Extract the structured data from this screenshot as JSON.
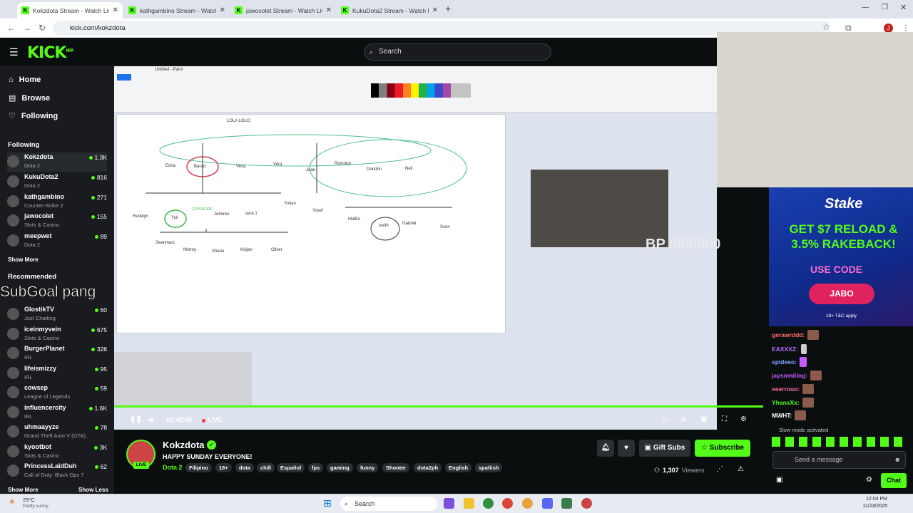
{
  "browser": {
    "tabs": [
      {
        "title": "Kokzdota Stream - Watch Live"
      },
      {
        "title": "kathgambino Stream - Watch Live"
      },
      {
        "title": "jawocolet Stream - Watch Live"
      },
      {
        "title": "KukuDota2 Stream - Watch Live"
      }
    ],
    "url": "kick.com/kokzdota",
    "profile_initial": "J"
  },
  "header": {
    "logo": "KICK",
    "logo_sup": "BETA",
    "search_placeholder": "Search"
  },
  "sidebar": {
    "nav": [
      {
        "label": "Home"
      },
      {
        "label": "Browse"
      },
      {
        "label": "Following"
      }
    ],
    "following_title": "Following",
    "following": [
      {
        "name": "Kokzdota",
        "category": "Dota 2",
        "viewers": "1.3K"
      },
      {
        "name": "KukuDota2",
        "category": "Dota 2",
        "viewers": "816"
      },
      {
        "name": "kathgambino",
        "category": "Counter-Strike 2",
        "viewers": "271"
      },
      {
        "name": "jawocolet",
        "category": "Slots & Casino",
        "viewers": "155"
      },
      {
        "name": "meepwet",
        "category": "Dota 2",
        "viewers": "89"
      }
    ],
    "show_more": "Show More",
    "recommended_title": "Recommended",
    "recommended": [
      {
        "name": "GlostikTV",
        "category": "Just Chatting",
        "viewers": "60"
      },
      {
        "name": "iceinmyvein",
        "category": "Slots & Casino",
        "viewers": "675"
      },
      {
        "name": "BurgerPlanet",
        "category": "IRL",
        "viewers": "328"
      },
      {
        "name": "lifeismizzy",
        "category": "IRL",
        "viewers": "95"
      },
      {
        "name": "cowsep",
        "category": "League of Legends",
        "viewers": "59"
      },
      {
        "name": "influencercity",
        "category": "IRL",
        "viewers": "1.6K"
      },
      {
        "name": "uhmaayyze",
        "category": "Grand Theft Auto V (GTA)",
        "viewers": "78"
      },
      {
        "name": "kyootbot",
        "category": "Slots & Casino",
        "viewers": "3K"
      },
      {
        "name": "PrincessLaidDuh",
        "category": "Call of Duty: Black Ops 7",
        "viewers": "62"
      }
    ],
    "show_more_2": "Show More",
    "show_less": "Show Less"
  },
  "video": {
    "overlay_text": "SubGoal pang",
    "bp_text": "BP 589/800",
    "paint_title": "Untitled - Paint",
    "diagram_labels": [
      "LOLA LOLO",
      "Edna",
      "Barad",
      "Vesa",
      "Vera",
      "Joan",
      "Romnick",
      "Dondon",
      "Neil",
      "Rudelyn",
      "Yuri",
      "EXPOSURE",
      "Johnrex",
      "vera 1",
      "Yohan",
      "Yosef",
      "MatEo",
      "keith",
      "Gabriel",
      "Sven",
      "Seanmarc",
      "Mctroy",
      "Shane",
      "Kidjan",
      "Oliver"
    ],
    "time": "02:42:00",
    "live": "LIVE"
  },
  "ad": {
    "brand": "Stake",
    "headline": "GET $7 RELOAD & 3.5% RAKEBACK!",
    "use_code": "USE CODE",
    "code": "JABO",
    "terms": "18+ T&C apply"
  },
  "chat": {
    "messages": [
      {
        "user": "gerawrddd:",
        "color": "#ff6b6b"
      },
      {
        "user": "EAXXXZ:",
        "color": "#b46bff"
      },
      {
        "user": "spideeo:",
        "color": "#7aa7ff"
      },
      {
        "user": "jaysnmiting:",
        "color": "#c45bff"
      },
      {
        "user": "eeerrooo:",
        "color": "#ff6b9d"
      },
      {
        "user": "YhanxXx:",
        "color": "#53fc18"
      },
      {
        "user": "MWHT:",
        "color": "#ffffff"
      }
    ],
    "slow_mode": "Slow mode activated",
    "placeholder": "Send a message",
    "chat_button": "Chat"
  },
  "stream": {
    "streamer": "Kokzdota",
    "title": "HAPPY SUNDAY EVERYONE!",
    "category": "Dota 2",
    "tags": [
      "Filipino",
      "18+",
      "dota",
      "chill",
      "Español",
      "fps",
      "gaming",
      "funny",
      "Shooter",
      "dota2ph",
      "English",
      "spañish"
    ],
    "gift_subs": "Gift Subs",
    "subscribe": "Subscribe",
    "viewers": "1,307",
    "viewers_label": "Viewers",
    "live_badge": "LIVE"
  },
  "taskbar": {
    "weather_temp": "29°C",
    "weather_desc": "Partly sunny",
    "search": "Search",
    "time": "12:04 PM",
    "date": "11/23/2025"
  }
}
